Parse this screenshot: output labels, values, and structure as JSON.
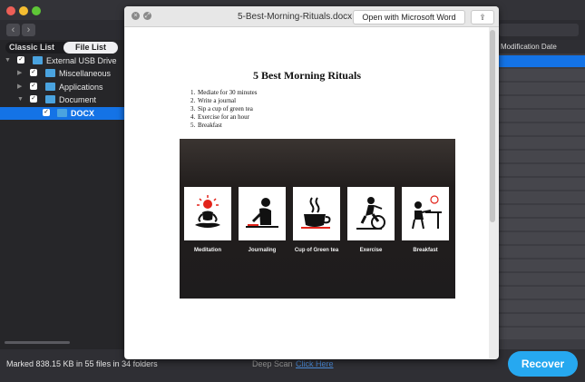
{
  "sidebar": {
    "segments": {
      "classic": "Classic List",
      "file": "File List"
    },
    "tree": [
      {
        "label": "External USB Drive",
        "checked": true,
        "expanded": true
      },
      {
        "label": "Miscellaneous",
        "checked": true,
        "expanded": false
      },
      {
        "label": "Applications",
        "checked": true,
        "expanded": false
      },
      {
        "label": "Document",
        "checked": true,
        "expanded": true
      },
      {
        "label": "DOCX",
        "checked": true,
        "selected": true
      }
    ]
  },
  "right_panel": {
    "column_header": "Modification Date"
  },
  "status": {
    "marked": "Marked 838.15 KB in 55 files in 34 folders",
    "deep_scan_label": "Deep Scan",
    "deep_scan_link": "Click Here"
  },
  "recover_button": "Recover",
  "quicklook": {
    "filename": "5-Best-Morning-Rituals.docx",
    "open_button": "Open with Microsoft Word",
    "share_icon": "share-icon",
    "document": {
      "title": "5 Best Morning Rituals",
      "items": [
        {
          "n": "1.",
          "text": "Mediate for 30 minutes"
        },
        {
          "n": "2.",
          "text": "Write a journal"
        },
        {
          "n": "3.",
          "text": "Sip a cup of green tea"
        },
        {
          "n": "4.",
          "text": "Exercise for an hour"
        },
        {
          "n": "5.",
          "text": "Breakfast"
        }
      ],
      "cards": [
        {
          "label": "Meditation",
          "icon": "meditation-icon"
        },
        {
          "label": "Journaling",
          "icon": "journaling-icon"
        },
        {
          "label": "Cup of Green tea",
          "icon": "tea-cup-icon"
        },
        {
          "label": "Exercise",
          "icon": "exercise-bike-icon"
        },
        {
          "label": "Breakfast",
          "icon": "breakfast-icon"
        }
      ]
    }
  },
  "colors": {
    "accent": "#1473e6",
    "recover": "#26a8f0",
    "folder": "#4aa3df"
  }
}
